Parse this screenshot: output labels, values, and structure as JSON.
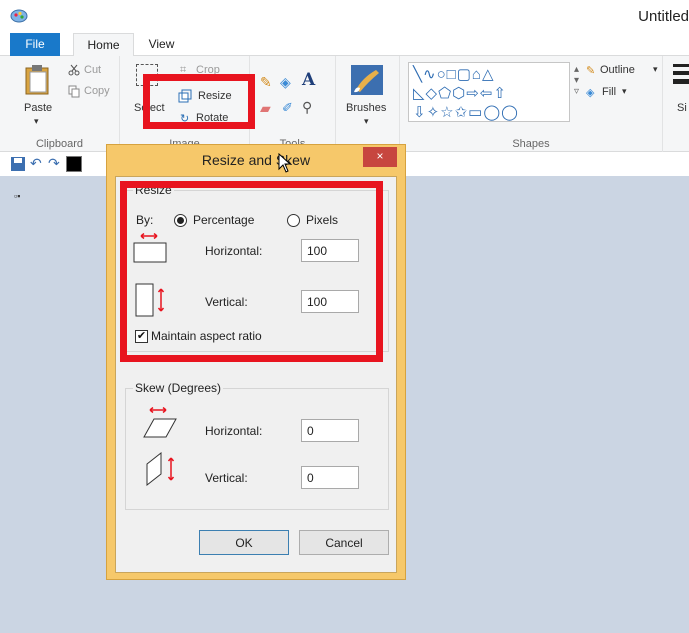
{
  "window": {
    "title": "Untitled"
  },
  "tabs": {
    "file": "File",
    "home": "Home",
    "view": "View"
  },
  "ribbon": {
    "clipboard": {
      "paste": "Paste",
      "cut": "Cut",
      "copy": "Copy",
      "label": "Clipboard"
    },
    "image": {
      "crop": "Crop",
      "select": "Select",
      "resize": "Resize",
      "rotate": "Rotate",
      "label": "Image"
    },
    "tools": {
      "label": "Tools",
      "text_glyph": "A"
    },
    "brushes": {
      "label": "Brushes"
    },
    "shapes": {
      "label": "Shapes",
      "outline": "Outline",
      "fill": "Fill"
    },
    "size": {
      "label": "Si"
    }
  },
  "dialog": {
    "title": "Resize and Skew",
    "close": "×",
    "resize": {
      "legend": "Resize",
      "by_label": "By:",
      "percentage": "Percentage",
      "pixels": "Pixels",
      "selected": "Percentage",
      "horizontal_label": "Horizontal:",
      "horizontal_value": "100",
      "vertical_label": "Vertical:",
      "vertical_value": "100",
      "maintain_aspect_ratio": "Maintain aspect ratio",
      "maintain_checked": true
    },
    "skew": {
      "legend": "Skew (Degrees)",
      "horizontal_label": "Horizontal:",
      "horizontal_value": "0",
      "vertical_label": "Vertical:",
      "vertical_value": "0"
    },
    "ok": "OK",
    "cancel": "Cancel"
  },
  "colors": {
    "accent": "#1979ca",
    "annotation": "#e8141f",
    "dialog_frame": "#f6c86a",
    "canvas_bg": "#cbd5e3",
    "arrow": "#e8141f"
  },
  "icons": [
    "paint-app-icon",
    "paste-icon",
    "cut-icon",
    "copy-icon",
    "select-icon",
    "crop-icon",
    "resize-icon",
    "rotate-icon",
    "pencil-icon",
    "fill-icon",
    "text-icon",
    "eraser-icon",
    "color-picker-icon",
    "magnifier-icon",
    "brushes-icon",
    "shapes-gallery-icon",
    "outline-icon",
    "fill-shape-icon",
    "save-icon",
    "undo-icon",
    "redo-icon",
    "cursor-icon"
  ]
}
